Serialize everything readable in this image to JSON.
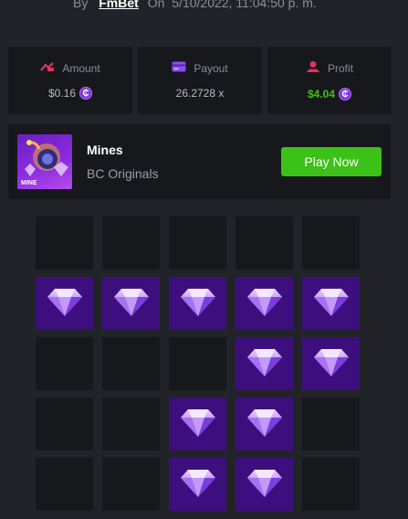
{
  "byline": {
    "by_label": "By",
    "username": "FmBet",
    "on_label": "On",
    "datetime": "5/10/2022, 11:04:50 p. m."
  },
  "stats": [
    {
      "label": "Amount",
      "value": "$0.16",
      "icon": "bet-amount-icon",
      "coin": true,
      "value_color": "#b9bbc4"
    },
    {
      "label": "Payout",
      "value": "26.2728 x",
      "icon": "payout-card-icon",
      "coin": false,
      "value_color": "#b9bbc4"
    },
    {
      "label": "Profit",
      "value": "$4.04",
      "icon": "profit-icon",
      "coin": true,
      "value_color": "#3bc117"
    }
  ],
  "game": {
    "thumb_label": "MINE",
    "title": "Mines",
    "subtitle": "BC Originals",
    "play_label": "Play Now"
  },
  "board": {
    "rows": 5,
    "cols": 5,
    "cells": [
      "empty",
      "empty",
      "empty",
      "empty",
      "empty",
      "gem",
      "gem",
      "gem",
      "gem",
      "gem",
      "empty",
      "empty",
      "empty",
      "gem",
      "gem",
      "empty",
      "empty",
      "gem",
      "gem",
      "empty",
      "empty",
      "empty",
      "gem",
      "gem",
      "empty"
    ]
  },
  "colors": {
    "background": "#222328",
    "panel": "#17181b",
    "accent_green": "#3bc117",
    "gem_tile": "#3d0f7e",
    "coin": "#7b35d8"
  }
}
